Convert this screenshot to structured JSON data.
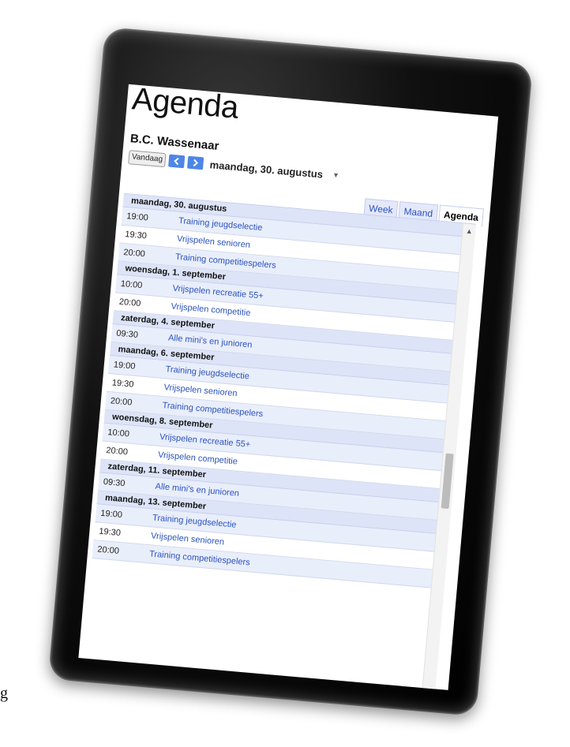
{
  "page": {
    "title": "Agenda",
    "stray_glyph": "g"
  },
  "calendar": {
    "name": "B.C. Wassenaar"
  },
  "toolbar": {
    "today_label": "Vandaag",
    "prev_icon": "chevron-left-icon",
    "next_icon": "chevron-right-icon",
    "current_date": "maandag, 30. augustus",
    "dropdown_icon": "triangle-down-icon"
  },
  "tabs": [
    {
      "label": "Week",
      "active": false
    },
    {
      "label": "Maand",
      "active": false
    },
    {
      "label": "Agenda",
      "active": true
    }
  ],
  "colors": {
    "accent": "#4d86e6",
    "link": "#2a52be",
    "header_bg": "#dde4f7",
    "row_alt": "#e9eefb",
    "frame": "#000000"
  },
  "agenda": {
    "days": [
      {
        "label": "maandag, 30. augustus",
        "events": [
          {
            "time": "19:00",
            "title": "Training jeugdselectie"
          },
          {
            "time": "19:30",
            "title": "Vrijspelen senioren"
          },
          {
            "time": "20:00",
            "title": "Training competitiespelers"
          }
        ]
      },
      {
        "label": "woensdag, 1. september",
        "events": [
          {
            "time": "10:00",
            "title": "Vrijspelen recreatie 55+"
          },
          {
            "time": "20:00",
            "title": "Vrijspelen competitie"
          }
        ]
      },
      {
        "label": "zaterdag, 4. september",
        "events": [
          {
            "time": "09:30",
            "title": "Alle mini's en junioren"
          }
        ]
      },
      {
        "label": "maandag, 6. september",
        "events": [
          {
            "time": "19:00",
            "title": "Training jeugdselectie"
          },
          {
            "time": "19:30",
            "title": "Vrijspelen senioren"
          },
          {
            "time": "20:00",
            "title": "Training competitiespelers"
          }
        ]
      },
      {
        "label": "woensdag, 8. september",
        "events": [
          {
            "time": "10:00",
            "title": "Vrijspelen recreatie 55+"
          },
          {
            "time": "20:00",
            "title": "Vrijspelen competitie"
          }
        ]
      },
      {
        "label": "zaterdag, 11. september",
        "events": [
          {
            "time": "09:30",
            "title": "Alle mini's en junioren"
          }
        ]
      },
      {
        "label": "maandag, 13. september",
        "events": [
          {
            "time": "19:00",
            "title": "Training jeugdselectie"
          },
          {
            "time": "19:30",
            "title": "Vrijspelen senioren"
          },
          {
            "time": "20:00",
            "title": "Training competitiespelers"
          }
        ]
      }
    ]
  },
  "scrollbar": {
    "up_icon": "triangle-up-icon",
    "position": 0.5
  }
}
